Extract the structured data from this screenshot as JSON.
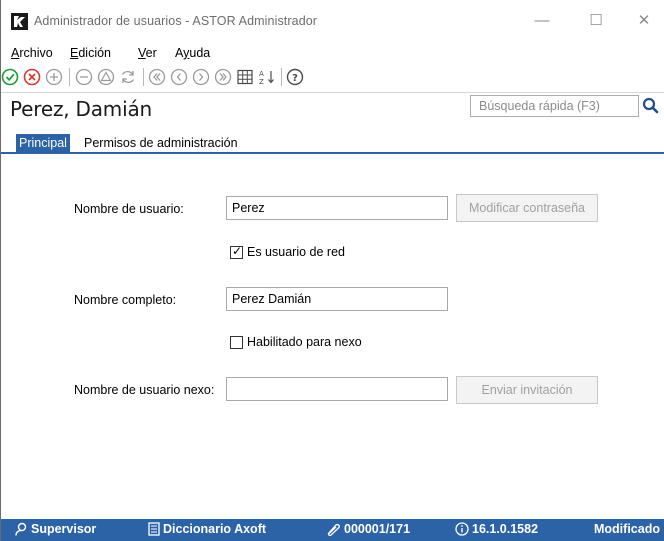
{
  "window": {
    "title": "Administrador de usuarios - ASTOR Administrador",
    "minimize_glyph": "—",
    "maximize_glyph": "☐",
    "close_glyph": "✕"
  },
  "menu": {
    "archivo": {
      "accel": "A",
      "rest": "rchivo"
    },
    "edicion": {
      "accel": "E",
      "rest": "dición"
    },
    "ver": {
      "accel": "V",
      "rest": "er"
    },
    "ayuda": {
      "lead": "A",
      "accel": "y",
      "rest": "uda"
    }
  },
  "toolbar": {
    "icons": [
      "accept-icon",
      "cancel-icon",
      "add-icon",
      "remove-icon",
      "delete-icon",
      "refresh-icon",
      "first-icon",
      "previous-icon",
      "next-icon",
      "last-icon",
      "grid-icon",
      "sort-icon",
      "help-icon"
    ],
    "colors": {
      "accept": "#1e9a3a",
      "cancel": "#d43a2f",
      "disabled": "#9a9a9a",
      "normal": "#4a4a4a"
    }
  },
  "header": {
    "record_title": "Perez, Damián",
    "search_placeholder": "Búsqueda rápida (F3)"
  },
  "tabs": {
    "principal": "Principal",
    "permisos": "Permisos de administración"
  },
  "form": {
    "username_label": "Nombre de usuario:",
    "username_value": "Perez",
    "change_password_button": "Modificar contraseña",
    "network_user_label": "Es usuario de red",
    "network_user_checked": true,
    "full_name_label": "Nombre completo:",
    "full_name_value": "Perez Damián",
    "nexo_enabled_label": "Habilitado para nexo",
    "nexo_enabled_checked": false,
    "nexo_username_label": "Nombre de usuario nexo:",
    "nexo_username_value": "",
    "send_invitation_button": "Enviar invitación"
  },
  "statusbar": {
    "user": "Supervisor",
    "dictionary": "Diccionario Axoft",
    "record": "000001/171",
    "version": "16.1.0.1582",
    "state": "Modificado"
  },
  "colors": {
    "accent": "#2c63a6",
    "status_bg": "#2c63a6"
  }
}
